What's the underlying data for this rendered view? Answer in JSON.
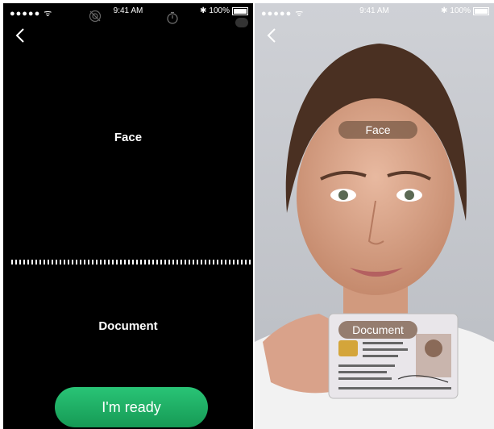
{
  "left": {
    "status": {
      "signal": "●●●●● ᯤ",
      "time": "9:41 AM",
      "battery": "100%",
      "battery_level": 1.0
    },
    "face_label": "Face",
    "document_label": "Document",
    "ready_button": "I'm ready"
  },
  "right": {
    "status": {
      "signal": "●●●●● ᯤ",
      "time": "9:41 AM",
      "battery": "100%",
      "battery_level": 1.0
    },
    "face_label": "Face",
    "document_label": "Document"
  }
}
